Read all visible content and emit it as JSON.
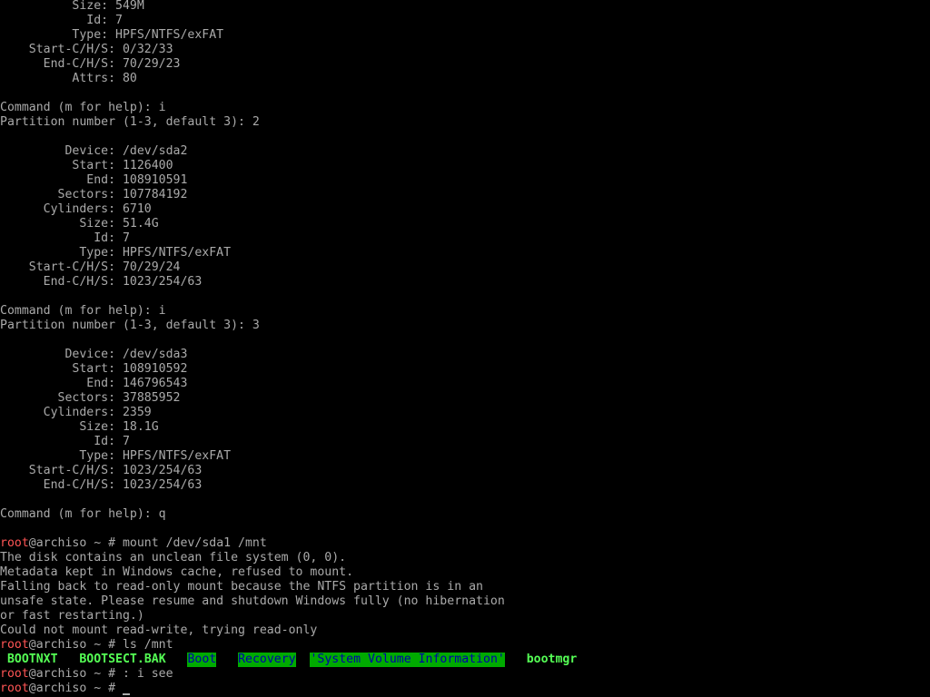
{
  "colors": {
    "background": "#000000",
    "text": "#aaaaaa",
    "prompt_user": "#ff5555",
    "ls_exec": "#55ff55",
    "ls_dir_bg": "#00aa00",
    "ls_dir_fg": "#0000aa"
  },
  "lines": [
    {
      "text": "          Size: 549M"
    },
    {
      "text": "            Id: 7"
    },
    {
      "text": "          Type: HPFS/NTFS/exFAT"
    },
    {
      "text": "    Start-C/H/S: 0/32/33"
    },
    {
      "text": "      End-C/H/S: 70/29/23"
    },
    {
      "text": "          Attrs: 80"
    },
    {
      "text": ""
    },
    {
      "text": "Command (m for help): i"
    },
    {
      "text": "Partition number (1-3, default 3): 2"
    },
    {
      "text": ""
    },
    {
      "text": "         Device: /dev/sda2"
    },
    {
      "text": "          Start: 1126400"
    },
    {
      "text": "            End: 108910591"
    },
    {
      "text": "        Sectors: 107784192"
    },
    {
      "text": "      Cylinders: 6710"
    },
    {
      "text": "           Size: 51.4G"
    },
    {
      "text": "             Id: 7"
    },
    {
      "text": "           Type: HPFS/NTFS/exFAT"
    },
    {
      "text": "    Start-C/H/S: 70/29/24"
    },
    {
      "text": "      End-C/H/S: 1023/254/63"
    },
    {
      "text": ""
    },
    {
      "text": "Command (m for help): i"
    },
    {
      "text": "Partition number (1-3, default 3): 3"
    },
    {
      "text": ""
    },
    {
      "text": "         Device: /dev/sda3"
    },
    {
      "text": "          Start: 108910592"
    },
    {
      "text": "            End: 146796543"
    },
    {
      "text": "        Sectors: 37885952"
    },
    {
      "text": "      Cylinders: 2359"
    },
    {
      "text": "           Size: 18.1G"
    },
    {
      "text": "             Id: 7"
    },
    {
      "text": "           Type: HPFS/NTFS/exFAT"
    },
    {
      "text": "    Start-C/H/S: 1023/254/63"
    },
    {
      "text": "      End-C/H/S: 1023/254/63"
    },
    {
      "text": ""
    },
    {
      "text": "Command (m for help): q"
    },
    {
      "text": ""
    },
    {
      "prompt": {
        "user": "root",
        "rest": "@archiso ~ # mount /dev/sda1 /mnt"
      }
    },
    {
      "text": "The disk contains an unclean file system (0, 0)."
    },
    {
      "text": "Metadata kept in Windows cache, refused to mount."
    },
    {
      "text": "Falling back to read-only mount because the NTFS partition is in an"
    },
    {
      "text": "unsafe state. Please resume and shutdown Windows fully (no hibernation"
    },
    {
      "text": "or fast restarting.)"
    },
    {
      "text": "Could not mount read-write, trying read-only"
    },
    {
      "prompt": {
        "user": "root",
        "rest": "@archiso ~ # ls /mnt"
      }
    },
    {
      "ls": [
        {
          "prefix": " ",
          "name": "BOOTNXT",
          "kind": "exec",
          "suffix": "   "
        },
        {
          "prefix": "",
          "name": "BOOTSECT.BAK",
          "kind": "exec",
          "suffix": "   "
        },
        {
          "prefix": "",
          "name": "Boot",
          "kind": "dir",
          "suffix": "   "
        },
        {
          "prefix": "",
          "name": "Recovery",
          "kind": "dir",
          "suffix": "  "
        },
        {
          "prefix": "",
          "name": "'System Volume Information'",
          "kind": "dir",
          "suffix": "   "
        },
        {
          "prefix": "",
          "name": "bootmgr",
          "kind": "exec",
          "suffix": ""
        }
      ]
    },
    {
      "prompt": {
        "user": "root",
        "rest": "@archiso ~ # : i see"
      }
    },
    {
      "prompt": {
        "user": "root",
        "rest": "@archiso ~ # "
      },
      "cursor": true
    }
  ]
}
